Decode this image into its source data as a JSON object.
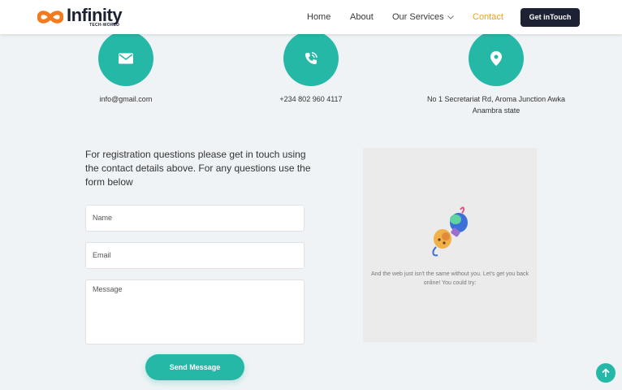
{
  "brand": {
    "name": "Infinity",
    "tagline": "TECH-WORLD"
  },
  "nav": {
    "home": "Home",
    "about": "About",
    "services": "Our Services",
    "contact": "Contact",
    "cta": "Get inTouch"
  },
  "contact_info": {
    "email": "info@gmail.com",
    "phone": "+234 802 960 4117",
    "address_line1": "No 1 Secretariat Rd, Aroma Junction Awka",
    "address_line2": "Anambra state"
  },
  "form": {
    "intro": "For registration questions please get in touch using the contact details above. For any questions use the form below",
    "name_placeholder": "Name",
    "email_placeholder": "Email",
    "message_placeholder": "Message",
    "submit_label": "Send Message"
  },
  "offline": {
    "message": "And the web just isn't the same without you. Let's get you back online! You could try:"
  },
  "colors": {
    "accent": "#26b8a7",
    "dark": "#1c2233",
    "active_nav": "#f0a216"
  }
}
